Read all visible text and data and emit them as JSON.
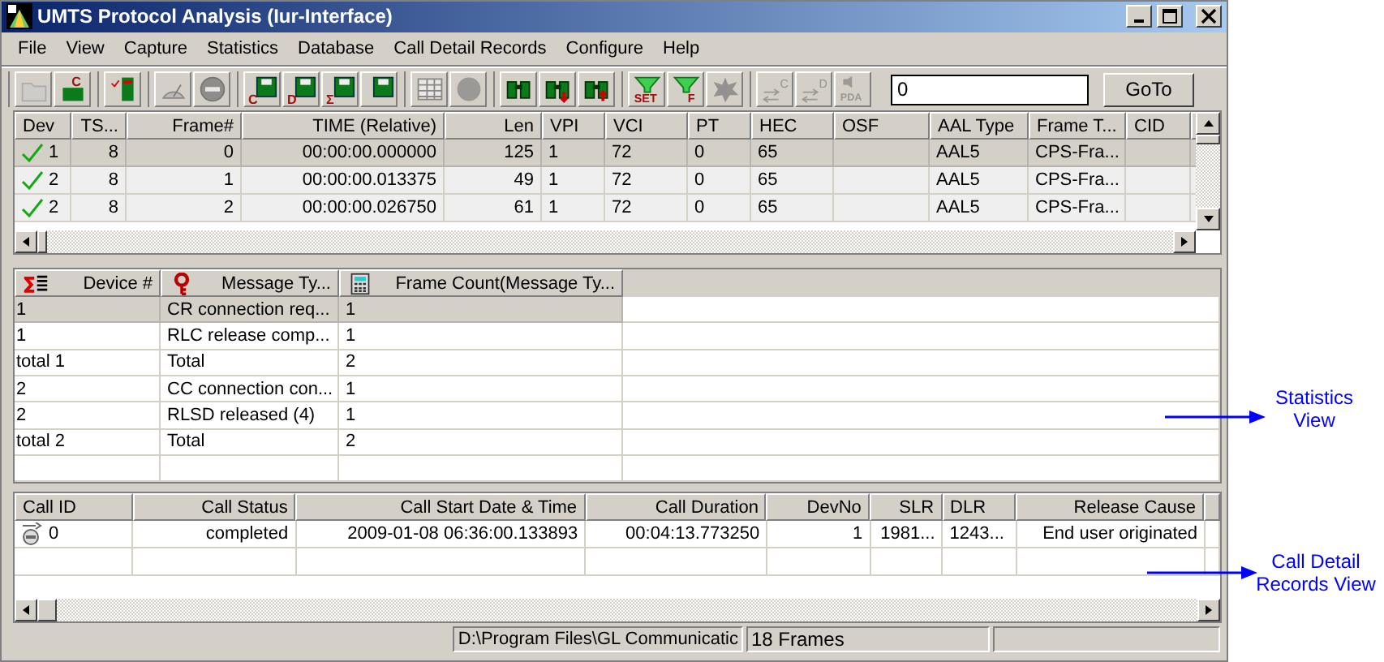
{
  "window": {
    "title": "UMTS Protocol Analysis (Iur-Interface)"
  },
  "menu": [
    "File",
    "View",
    "Capture",
    "Statistics",
    "Database",
    "Call Detail Records",
    "Configure",
    "Help"
  ],
  "toolbar": [
    [
      {
        "kind": "folder",
        "disabled": true
      },
      {
        "kind": "capture",
        "glyph": "C",
        "disabled": false
      }
    ],
    [
      {
        "kind": "checklist",
        "disabled": false
      }
    ],
    [
      {
        "kind": "gauge",
        "disabled": true
      },
      {
        "kind": "stop",
        "disabled": true
      }
    ],
    [
      {
        "kind": "save",
        "glyph": "C",
        "disabled": false
      },
      {
        "kind": "save",
        "glyph": "D",
        "disabled": false
      },
      {
        "kind": "save",
        "glyph": "Σ",
        "disabled": false
      },
      {
        "kind": "save",
        "disabled": false
      }
    ],
    [
      {
        "kind": "table",
        "disabled": true
      },
      {
        "kind": "circle",
        "disabled": true
      }
    ],
    [
      {
        "kind": "binoculars",
        "disabled": false
      },
      {
        "kind": "binoculars-down",
        "disabled": false
      },
      {
        "kind": "binoculars-up",
        "disabled": false
      }
    ],
    [
      {
        "kind": "filter",
        "glyph": "SET",
        "disabled": false
      },
      {
        "kind": "filter",
        "glyph": "F",
        "disabled": false
      },
      {
        "kind": "burst",
        "disabled": true
      }
    ],
    [
      {
        "kind": "swap",
        "glyph": "C",
        "disabled": true
      },
      {
        "kind": "swap",
        "glyph": "D",
        "disabled": true
      },
      {
        "kind": "speaker",
        "glyph": "PDA",
        "disabled": true
      }
    ]
  ],
  "goto": {
    "value": "0",
    "button": "GoTo"
  },
  "frames": {
    "columns": [
      "Dev",
      "TS...",
      "Frame#",
      "TIME (Relative)",
      "Len",
      "VPI",
      "VCI",
      "PT",
      "HEC",
      "OSF",
      "AAL Type",
      "Frame T...",
      "CID"
    ],
    "rows": [
      {
        "ok": true,
        "selected": true,
        "cells": [
          "1",
          "8",
          "0",
          "00:00:00.000000",
          "125",
          "1",
          "72",
          "0",
          "65",
          "",
          "AAL5",
          "CPS-Fra...",
          ""
        ]
      },
      {
        "ok": true,
        "selected": false,
        "cells": [
          "2",
          "8",
          "1",
          "00:00:00.013375",
          "49",
          "1",
          "72",
          "0",
          "65",
          "",
          "AAL5",
          "CPS-Fra...",
          ""
        ]
      },
      {
        "ok": true,
        "selected": false,
        "cells": [
          "2",
          "8",
          "2",
          "00:00:00.026750",
          "61",
          "1",
          "72",
          "0",
          "65",
          "",
          "AAL5",
          "CPS-Fra...",
          ""
        ]
      }
    ]
  },
  "statistics": {
    "columns": [
      {
        "label": "Device #",
        "kind": "sigma"
      },
      {
        "label": "Message Ty...",
        "kind": "key"
      },
      {
        "label": "Frame Count(Message Ty...",
        "kind": "calculator"
      }
    ],
    "rows": [
      {
        "selected": true,
        "cells": [
          "1",
          "CR connection req...",
          "1"
        ]
      },
      {
        "selected": false,
        "cells": [
          "1",
          "RLC release comp...",
          "1"
        ]
      },
      {
        "selected": false,
        "cells": [
          "total 1",
          "Total",
          "2"
        ]
      },
      {
        "selected": false,
        "cells": [
          "2",
          "CC connection con...",
          "1"
        ]
      },
      {
        "selected": false,
        "cells": [
          "2",
          "RLSD released (4)",
          "1"
        ]
      },
      {
        "selected": false,
        "cells": [
          "total 2",
          "Total",
          "2"
        ]
      }
    ]
  },
  "call_records": {
    "columns": [
      "Call ID",
      "Call Status",
      "Call Start Date & Time",
      "Call Duration",
      "DevNo",
      "SLR",
      "DLR",
      "Release Cause"
    ],
    "rows": [
      {
        "cells": [
          "0",
          "completed",
          "2009-01-08 06:36:00.133893",
          "00:04:13.773250",
          "1",
          "1981...",
          "1243...",
          "End user originated"
        ]
      }
    ]
  },
  "status_bar": [
    "D:\\Program Files\\GL Communicatic",
    "18 Frames"
  ],
  "annotations": [
    "Statistics View",
    "Call Detail Records View"
  ]
}
